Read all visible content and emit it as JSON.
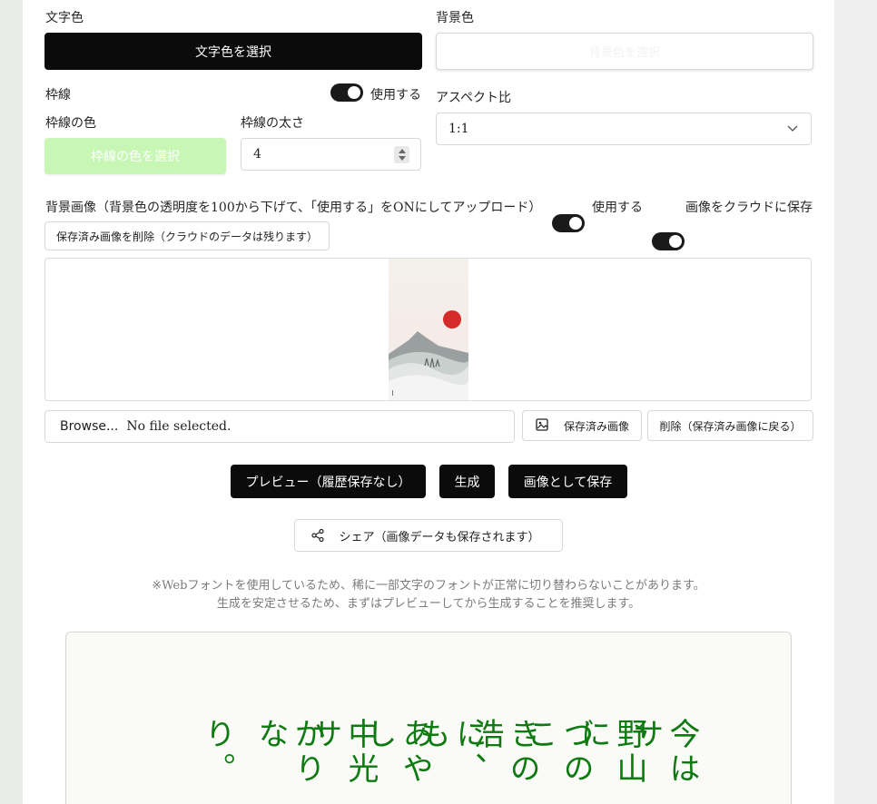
{
  "text_color": {
    "label": "文字色",
    "button": "文字色を選択"
  },
  "bg_color": {
    "label": "背景色",
    "button": "背景色を選択"
  },
  "border": {
    "label": "枠線",
    "toggle_label": "使用する",
    "color_label": "枠線の色",
    "color_button": "枠線の色を選択",
    "width_label": "枠線の太さ",
    "width_value": "4",
    "color_hex": "#c8f7b5"
  },
  "aspect": {
    "label": "アスペクト比",
    "selected": "1:1"
  },
  "bg_image": {
    "label": "背景画像（背景色の透明度を100から下げて、「使用する」をONにしてアップロード）",
    "use_toggle_label": "使用する",
    "cloud_toggle_label": "画像をクラウドに保存",
    "delete_saved_button": "保存済み画像を削除（クラウドのデータは残ります）"
  },
  "file": {
    "browse_label": "Browse...",
    "status": "No file selected.",
    "saved_image_button": "保存済み画像",
    "delete_button": "削除（保存済み画像に戻る）"
  },
  "actions": {
    "preview": "プレビュー（履歴保存なし）",
    "generate": "生成",
    "save_image": "画像として保存",
    "share": "シェア（画像データも保存されます）"
  },
  "notes": {
    "line1": "※Webフォントを使用しているため、稀に一部文字のフォントが正常に切り替わらないことがあります。",
    "line2": "生成を安定させるため、まずはプレビューしてから生成することを推奨します。"
  },
  "preview_columns": [
    "今はサ",
    "野山に",
    "づのこ",
    "きの浩",
    "に、も",
    "あやし",
    "中光サ",
    "かりな",
    "り。"
  ],
  "colors": {
    "accent": "#0b0b0b",
    "text_green": "#0f7a12",
    "sun_red": "#d62a2a"
  },
  "icons": {
    "image": "image-icon",
    "share": "share-icon",
    "chevron": "chevron-down-icon"
  }
}
